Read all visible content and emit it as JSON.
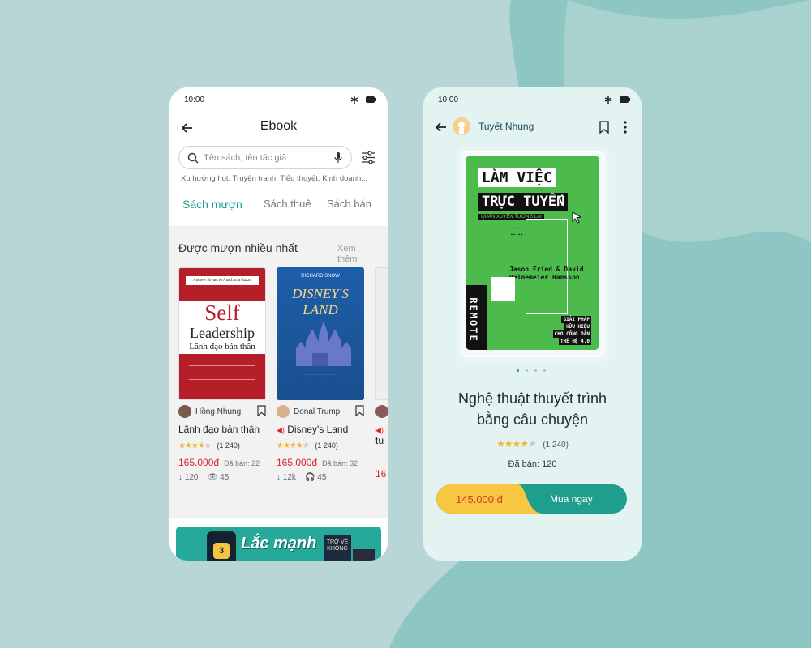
{
  "colors": {
    "background": "#b9d6d6",
    "accent": "#1f9e8e",
    "price": "#d9252a",
    "star": "#f0b429",
    "buy_left": "#f7c742"
  },
  "phone1": {
    "status_time": "10:00",
    "title": "Ebook",
    "search_placeholder": "Tên sách, tên tác giả",
    "trend_label": "Xu hướng hot:",
    "trend_items": "Truyện tranh, Tiểu thuyết, Kinh doanh...",
    "tabs": [
      "Sách mượn",
      "Sách thuê",
      "Sách bán"
    ],
    "active_tab": 0,
    "section_title": "Được mượn nhiều nhất",
    "see_more": "Xem thêm",
    "cards": [
      {
        "author": "Hồng Nhung",
        "title": "Lãnh đạo bản thân",
        "rating_count": "(1 240)",
        "stars": 4,
        "price": "165.000đ",
        "sold": "Đã bán: 22",
        "downloads": "120",
        "views": "45",
        "cover": {
          "top": "Andrew Bryant & Ana Lucia Kazan",
          "line1": "Self",
          "line2": "Leadership",
          "line3": "Lãnh đạo bản thân"
        }
      },
      {
        "author": "Donal Trump",
        "title": "Disney's Land",
        "rating_count": "(1 240)",
        "stars": 4,
        "price": "165.000đ",
        "sold": "Đã bán: 32",
        "downloads": "12k",
        "views": "45",
        "cover": {
          "top": "RICHARD SNOW",
          "line1": "DISNEY'S",
          "line2": "LAND"
        }
      },
      {
        "author": "",
        "title": "tư",
        "rating_count": "",
        "stars": 4,
        "price": "16",
        "sold": "",
        "downloads": "",
        "views": "",
        "cover": {}
      }
    ],
    "banner_text": "Lắc mạnh",
    "banner_badge": "3",
    "banner_book": "TRỞ VỀ KHÔNG"
  },
  "phone2": {
    "status_time": "10:00",
    "user_name": "Tuyết Nhung",
    "cover": {
      "line1": "LÀM VIỆC",
      "line2": "TRỰC TUYẾN",
      "subtitle": "QUẢN XUYẾN TƯƠNG LAI",
      "authors": "Jason Fried & David Heinemeier Hansson",
      "spine": "REMOTE",
      "tag": [
        "GIẢI PHÁP",
        "HỮU HIỆU",
        "CHO CÔNG DÂN",
        "THẾ HỆ 4.0"
      ]
    },
    "book_title": "Nghệ thuật thuyết trình bằng câu chuyện",
    "stars": 4,
    "rating_count": "(1 240)",
    "sold": "Đã bán: 120",
    "price": "145.000 đ",
    "buy_label": "Mua ngay"
  }
}
